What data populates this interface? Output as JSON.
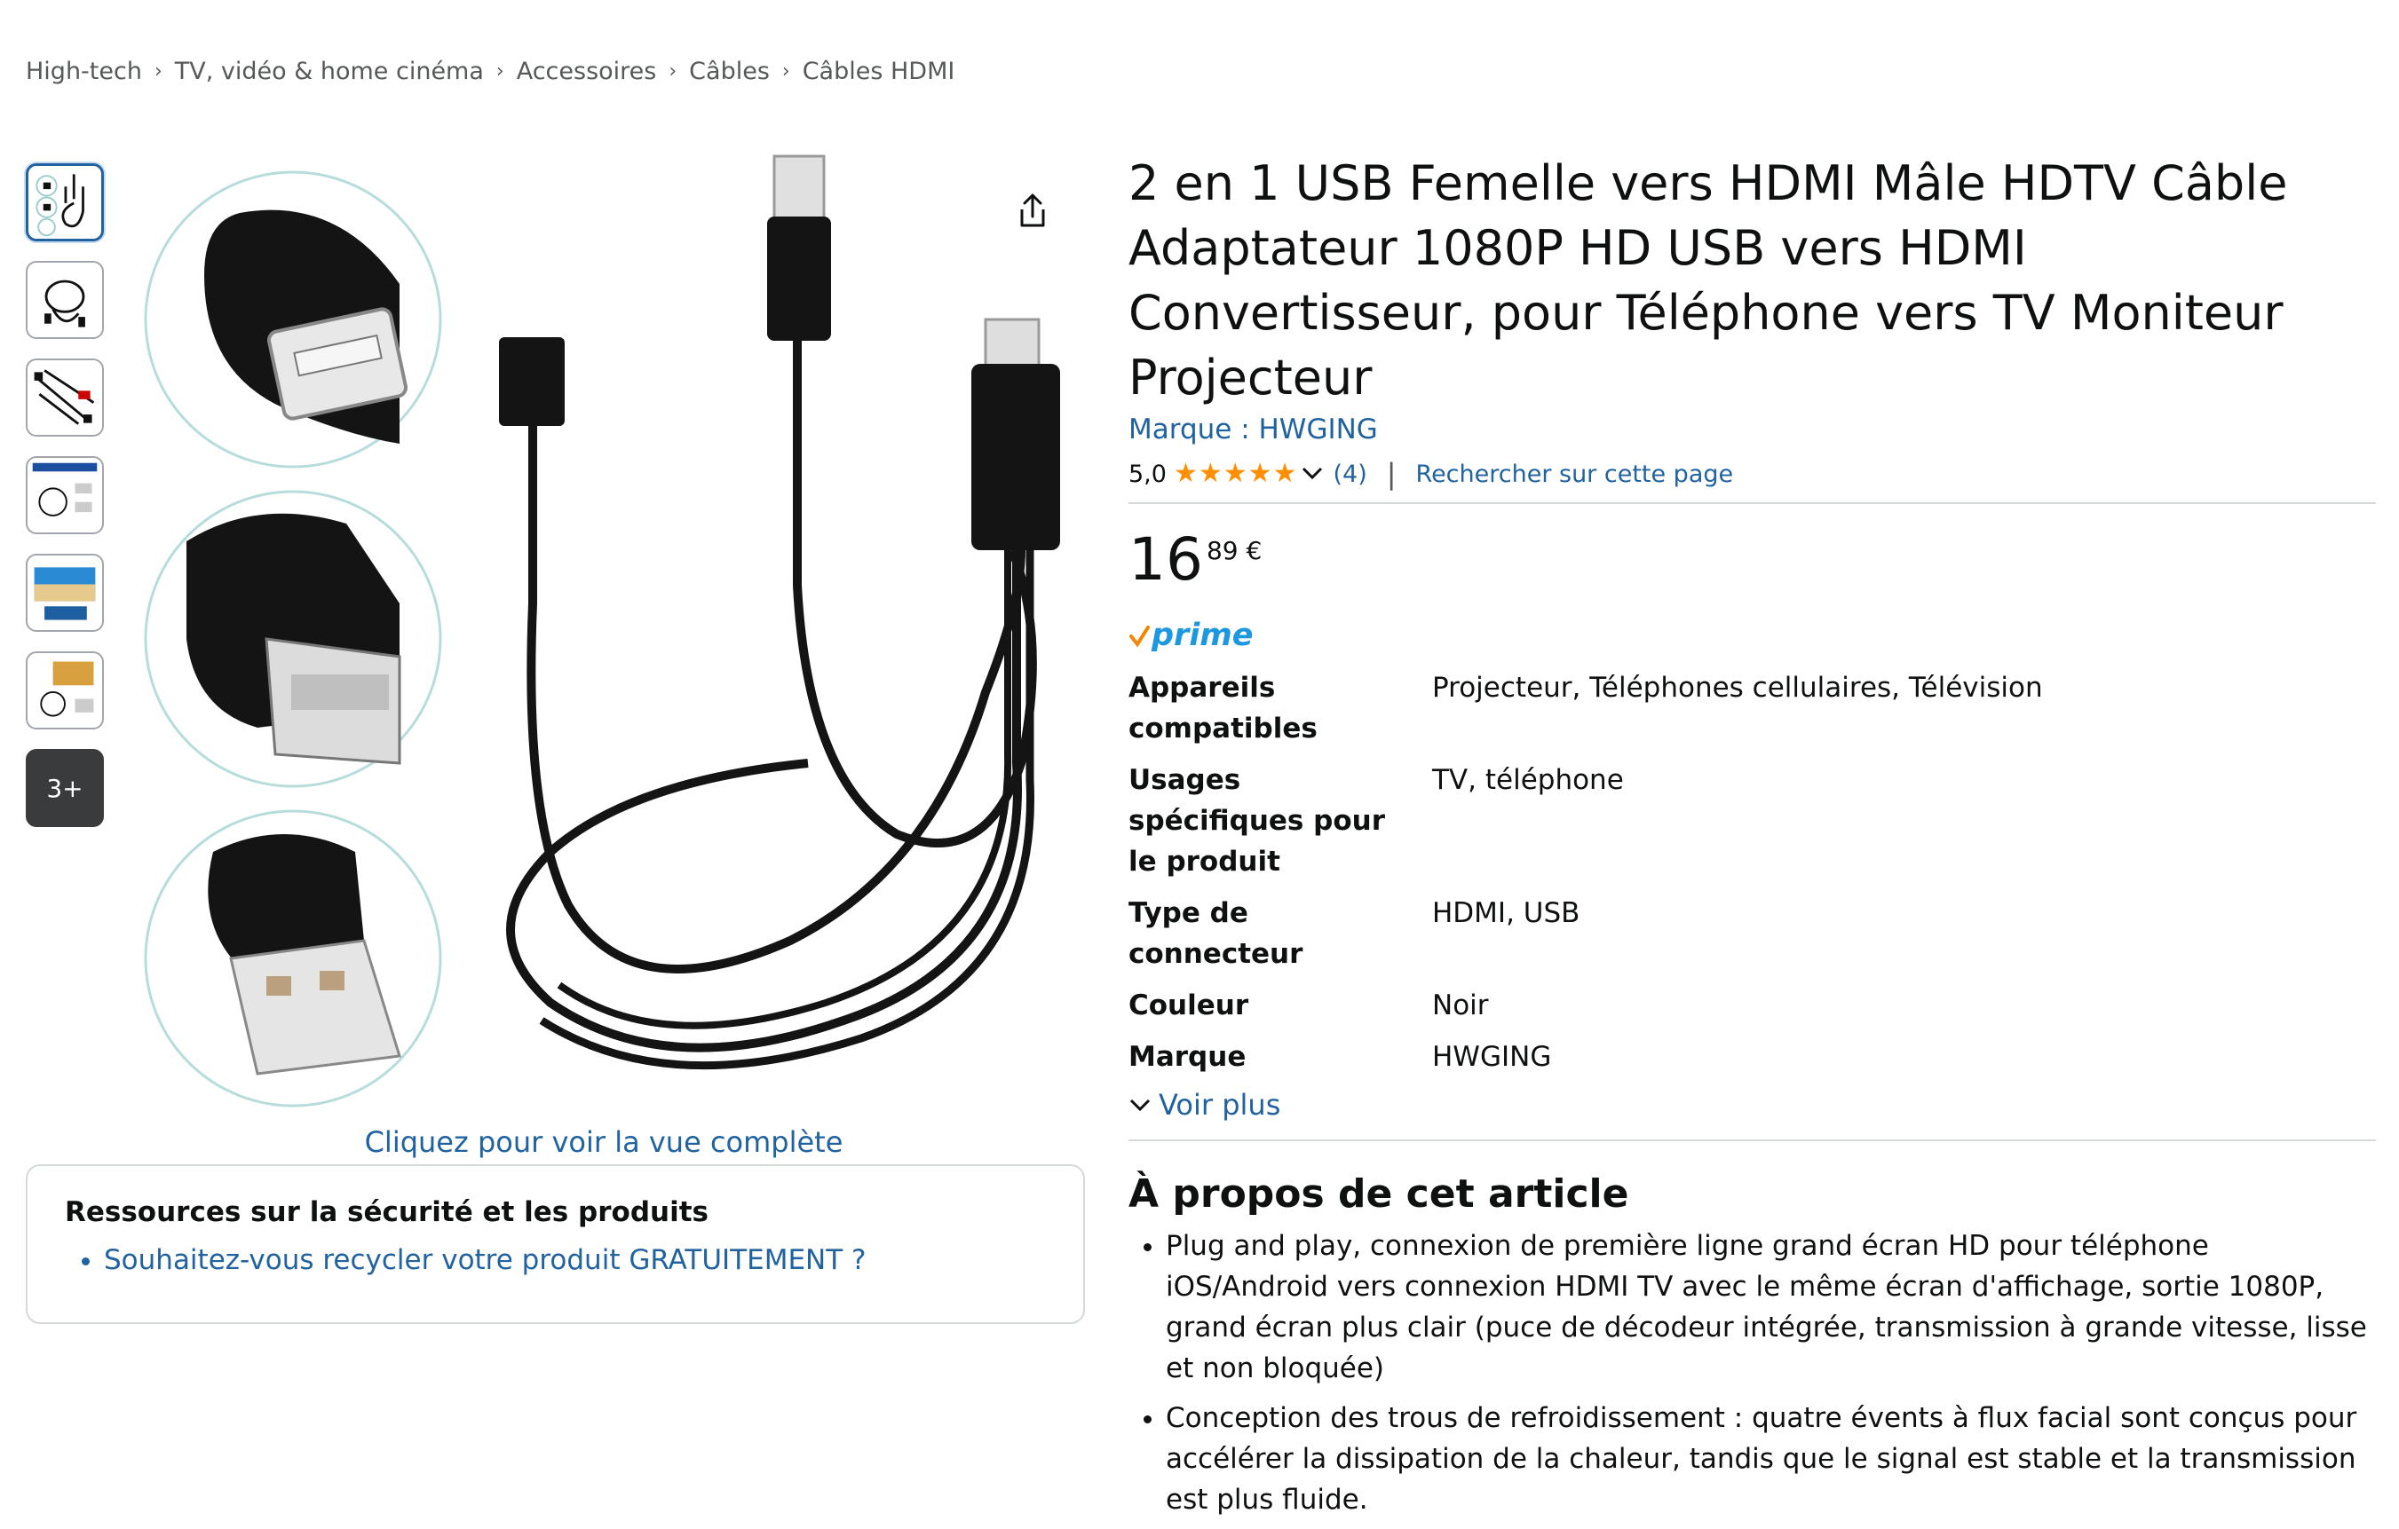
{
  "breadcrumb": [
    "High-tech",
    "TV, vidéo & home cinéma",
    "Accessoires",
    "Câbles",
    "Câbles HDMI"
  ],
  "gallery": {
    "more_label": "3+",
    "view_full": "Cliquez pour voir la vue complète"
  },
  "safety": {
    "title": "Ressources sur la sécurité et les produits",
    "link": "Souhaitez-vous recycler votre produit GRATUITEMENT ?"
  },
  "product": {
    "title": "2 en 1 USB Femelle vers HDMI Mâle HDTV Câble Adaptateur 1080P HD USB vers HDMI Convertisseur, pour Téléphone vers TV Moniteur Projecteur",
    "brand": "Marque : HWGING",
    "rating": "5,0",
    "stars": 5,
    "review_count": "(4)",
    "search_page": "Rechercher sur cette page",
    "price_whole": "16",
    "price_fraction": "89 €",
    "prime": "prime"
  },
  "specs": [
    {
      "key": "Appareils compatibles",
      "value": "Projecteur, Téléphones cellulaires, Télévision"
    },
    {
      "key": "Usages spécifiques pour le produit",
      "value": "TV, téléphone"
    },
    {
      "key": "Type de connecteur",
      "value": "HDMI, USB"
    },
    {
      "key": "Couleur",
      "value": "Noir"
    },
    {
      "key": "Marque",
      "value": "HWGING"
    }
  ],
  "voir_plus": "Voir plus",
  "about": {
    "title": "À propos de cet article",
    "items": [
      "Plug and play, connexion de première ligne grand écran HD pour téléphone iOS/Android vers connexion HDMI TV avec le même écran d'affichage, sortie 1080P, grand écran plus clair (puce de décodeur intégrée, transmission à grande vitesse, lisse et non bloquée)",
      "Conception des trous de refroidissement : quatre évents à flux facial sont conçus pour accélérer la dissipation de la chaleur, tandis que le signal est stable et la transmission est plus fluide."
    ]
  },
  "colors": {
    "link": "#2162a1",
    "star": "#ff8f00",
    "prime": "#1b98e0",
    "text": "#0f1111"
  }
}
